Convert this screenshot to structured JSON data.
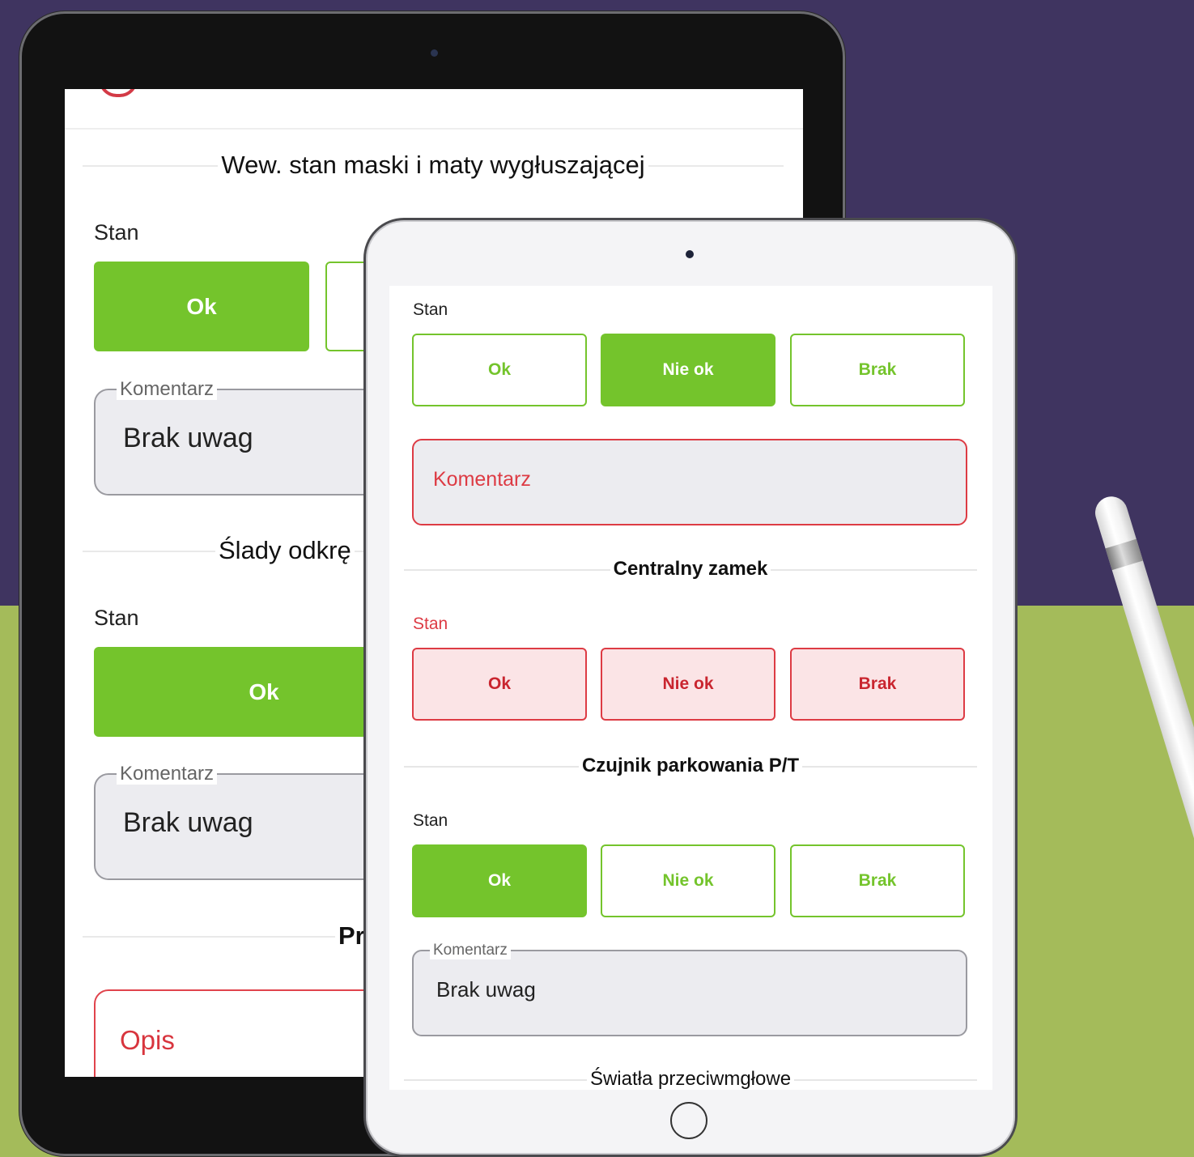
{
  "back_tablet": {
    "section1_title": "Wew. stan maski i maty wygłuszającej",
    "stan_label": "Stan",
    "ok_label": "Ok",
    "comment_legend": "Komentarz",
    "comment_value": "Brak uwag",
    "section2_title": "Ślady odkrę",
    "section3_title": "Pr",
    "opis_placeholder": "Opis"
  },
  "front_tablet": {
    "groups": [
      {
        "label": "Stan",
        "ok": "Ok",
        "nie_ok": "Nie ok",
        "brak": "Brak",
        "selected": "Nie ok"
      },
      {
        "label": "Stan",
        "ok": "Ok",
        "nie_ok": "Nie ok",
        "brak": "Brak",
        "state": "error"
      },
      {
        "label": "Stan",
        "ok": "Ok",
        "nie_ok": "Nie ok",
        "brak": "Brak",
        "selected": "Ok"
      }
    ],
    "komentarz_error_placeholder": "Komentarz",
    "sections": [
      "Centralny zamek",
      "Czujnik parkowania P/T",
      "Światła przeciwmgłowe"
    ],
    "comment_legend": "Komentarz",
    "comment_value": "Brak uwag"
  },
  "colors": {
    "accent_green": "#74c42c",
    "error_red": "#dd3b44",
    "bg_purple": "#3f3460",
    "bg_green": "#a4bb5a"
  }
}
